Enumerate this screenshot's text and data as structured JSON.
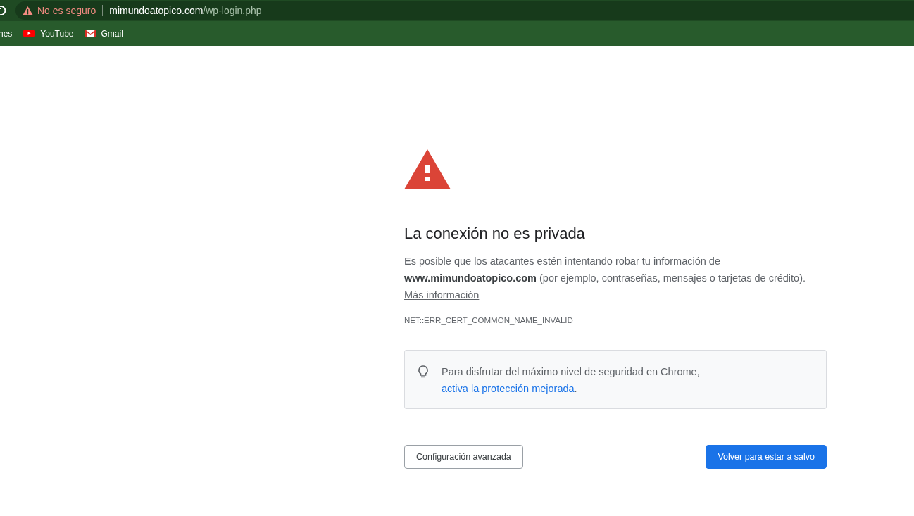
{
  "address_bar": {
    "security_label": "No es seguro",
    "host": "mimundoatopico.com",
    "path": "/wp-login.php"
  },
  "bookmarks": [
    {
      "label": "nes",
      "kind": "plain"
    },
    {
      "label": "YouTube",
      "kind": "youtube"
    },
    {
      "label": "Gmail",
      "kind": "mail"
    }
  ],
  "interstitial": {
    "heading": "La conexión no es privada",
    "description": "Es posible que los atacantes estén intentando robar tu información de **www.mimundoatopico.com** (por ejemplo, contraseñas, mensajes o tarjetas de crédito).",
    "more_link": "Más información",
    "error_code": "NET::ERR_CERT_COMMON_NAME_INVALID",
    "tip": {
      "text": "Para disfrutar del máximo nivel de seguridad en Chrome,",
      "link": "activa la protección mejorada",
      "after": "."
    },
    "buttons": [
      {
        "label": "Configuración avanzada",
        "kind": "secondary"
      },
      {
        "label": "Volver para estar a salvo",
        "kind": "primary"
      }
    ]
  }
}
